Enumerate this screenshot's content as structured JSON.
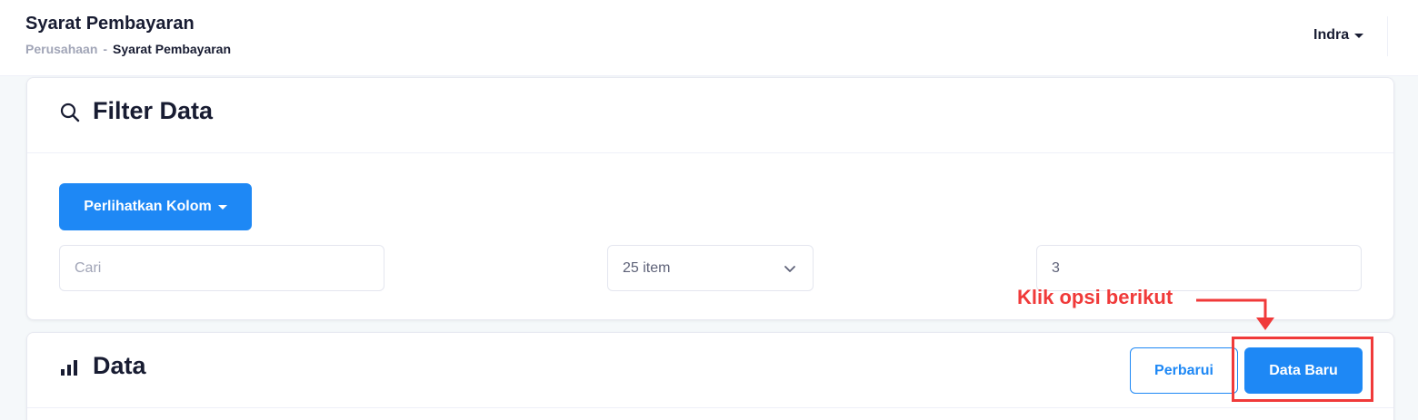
{
  "header": {
    "title": "Syarat Pembayaran",
    "breadcrumb": {
      "parent": "Perusahaan",
      "separator": "-",
      "current": "Syarat Pembayaran"
    },
    "user": "Indra"
  },
  "filter_card": {
    "title": "Filter Data",
    "icon": "search-icon",
    "columns_button": "Perlihatkan Kolom",
    "search_placeholder": "Cari",
    "items_per_page": "25 item",
    "page_value": "3"
  },
  "data_card": {
    "title": "Data",
    "icon": "bar-chart-icon",
    "refresh_button": "Perbarui",
    "new_button": "Data Baru"
  },
  "annotation": {
    "text": "Klik opsi berikut",
    "color": "#f03a3a"
  },
  "colors": {
    "primary": "#1e88f5",
    "text_dark": "#181c32",
    "text_muted": "#a1a5b7"
  }
}
